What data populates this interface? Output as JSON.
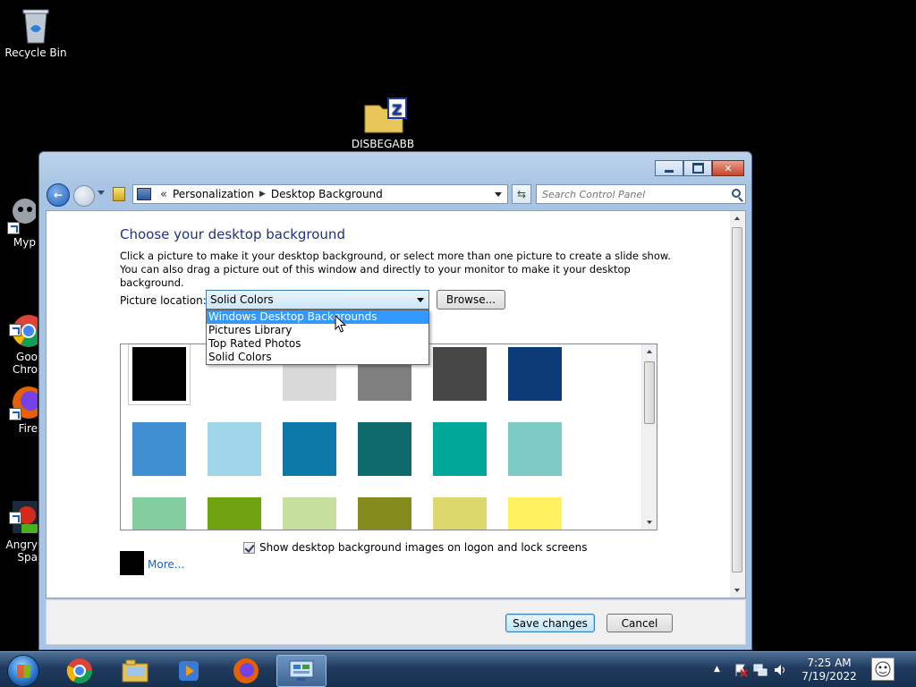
{
  "desktop": {
    "icons": [
      {
        "id": "recycle-bin",
        "label": "Recycle Bin"
      },
      {
        "id": "folder",
        "label": "DISBEGABB"
      },
      {
        "id": "myp",
        "label": "Myp"
      },
      {
        "id": "chrome",
        "label": "Goo\nChro"
      },
      {
        "id": "firefox",
        "label": "Fire"
      },
      {
        "id": "angry",
        "label": "Angry\nSpa"
      }
    ]
  },
  "window": {
    "address": {
      "sep": "«",
      "crumbs": [
        "Personalization",
        "Desktop Background"
      ]
    },
    "search": {
      "placeholder": "Search Control Panel"
    },
    "title": "Choose your desktop background",
    "description_line1": "Click a picture to make it your desktop background, or select more than one picture to create a slide show.",
    "description_line2": "You can also drag a picture out of this window and directly to your monitor to make it your desktop background.",
    "picture_location_label": "Picture location:",
    "picture_location_value": "Solid Colors",
    "browse_label": "Browse...",
    "dropdown_options": [
      "Windows Desktop Backgrounds",
      "Pictures Library",
      "Top Rated Photos",
      "Solid Colors"
    ],
    "swatches": [
      "#000000",
      "#ffffff",
      "#d9d9d9",
      "#808080",
      "#474747",
      "#0b3c78",
      "#3f8fd2",
      "#9fd6ea",
      "#0b78a8",
      "#0f6b6b",
      "#00a89a",
      "#7ecbc6",
      "#83cc9e",
      "#6fa310",
      "#c6de9e",
      "#868b1e",
      "#dcd86b",
      "#fff060"
    ],
    "show_logon_label": "Show desktop background images on logon and lock screens",
    "more_label": "More...",
    "save_label": "Save changes",
    "cancel_label": "Cancel"
  },
  "taskbar": {
    "time": "7:25 AM",
    "date": "7/19/2022"
  }
}
